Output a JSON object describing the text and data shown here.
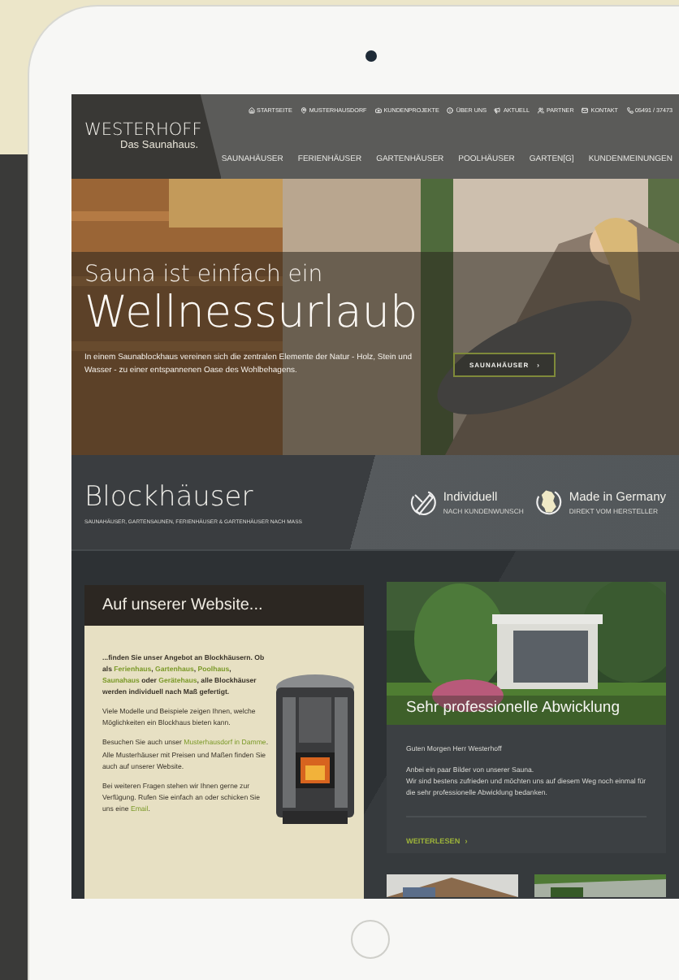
{
  "logo": {
    "name": "WESTERHOFF",
    "tagline": "Das Saunahaus."
  },
  "utility_nav": [
    {
      "kind": "home",
      "label": "STARTSEITE"
    },
    {
      "kind": "pin",
      "label": "MUSTERHAUSDORF"
    },
    {
      "kind": "camera",
      "label": "KUNDENPROJEKTE"
    },
    {
      "kind": "info",
      "label": "ÜBER UNS"
    },
    {
      "kind": "megaphone",
      "label": "AKTUELL"
    },
    {
      "kind": "people",
      "label": "PARTNER"
    },
    {
      "kind": "mail",
      "label": "KONTAKT"
    },
    {
      "kind": "phone",
      "label": "05491 / 37473"
    }
  ],
  "main_nav": [
    "SAUNAHÄUSER",
    "FERIENHÄUSER",
    "GARTENHÄUSER",
    "POOLHÄUSER",
    "GARTEN[G]",
    "KUNDENMEINUNGEN"
  ],
  "hero": {
    "kicker": "Sauna ist einfach ein",
    "headline": "Wellnessurlaub",
    "text": "In einem Saunablockhaus vereinen sich die zentralen Elemente der Natur - Holz, Stein und Wasser - zu einer entspannenen Oase des Wohlbehagens.",
    "button": "SAUNAHÄUSER",
    "button_arrow": "›"
  },
  "band": {
    "title": "Blockhäuser",
    "subtitle": "SAUNAHÄUSER, GARTENSAUNEN, FERIENHÄUSER & GARTENHÄUSER NACH MASS",
    "features": [
      {
        "kind": "pencil",
        "title": "Individuell",
        "subtitle": "NACH KUNDENWUNSCH"
      },
      {
        "kind": "map",
        "title": "Made in Germany",
        "subtitle": "DIREKT VOM HERSTELLER"
      }
    ]
  },
  "website_card": {
    "title": "Auf unserer Website...",
    "paragraphs": [
      {
        "bold": true,
        "parts": [
          {
            "kind": "text",
            "text": "...finden Sie unser Angebot an Blockhäusern. Ob als "
          },
          {
            "kind": "link",
            "text": "Ferienhaus"
          },
          {
            "kind": "text",
            "text": ", "
          },
          {
            "kind": "link",
            "text": "Gartenhaus"
          },
          {
            "kind": "text",
            "text": ", "
          },
          {
            "kind": "link",
            "text": "Poolhaus"
          },
          {
            "kind": "text",
            "text": ", "
          },
          {
            "kind": "link",
            "text": "Saunahaus"
          },
          {
            "kind": "text",
            "text": " oder "
          },
          {
            "kind": "link",
            "text": "Gerätehaus"
          },
          {
            "kind": "text",
            "text": ", alle Blockhäuser werden individuell nach Maß gefertigt."
          }
        ]
      },
      {
        "bold": false,
        "parts": [
          {
            "kind": "text",
            "text": "Viele Modelle und Beispiele zeigen Ihnen, welche Möglichkeiten ein Blockhaus bieten kann."
          }
        ]
      },
      {
        "bold": false,
        "parts": [
          {
            "kind": "text",
            "text": "Besuchen Sie auch unser "
          },
          {
            "kind": "link",
            "text": "Musterhausdorf in Damme"
          },
          {
            "kind": "text",
            "text": ". Alle Musterhäuser mit Preisen und Maßen finden Sie auch auf unserer Website."
          }
        ]
      },
      {
        "bold": false,
        "parts": [
          {
            "kind": "text",
            "text": "Bei weiteren Fragen stehen wir Ihnen gerne zur Verfügung. Rufen Sie einfach an oder schicken Sie uns eine "
          },
          {
            "kind": "link",
            "text": "Email"
          },
          {
            "kind": "text",
            "text": "."
          }
        ]
      }
    ]
  },
  "testimonial": {
    "title": "Sehr professionelle Abwicklung",
    "greeting": "Guten Morgen Herr Westerhoff",
    "lines": [
      "Anbei ein paar Bilder von unserer Sauna.",
      "Wir sind bestens zufrieden und möchten uns auf diesem Weg noch einmal für die sehr professionelle Abwicklung bedanken."
    ],
    "link": "WEITERLESEN",
    "link_arrow": "›"
  }
}
